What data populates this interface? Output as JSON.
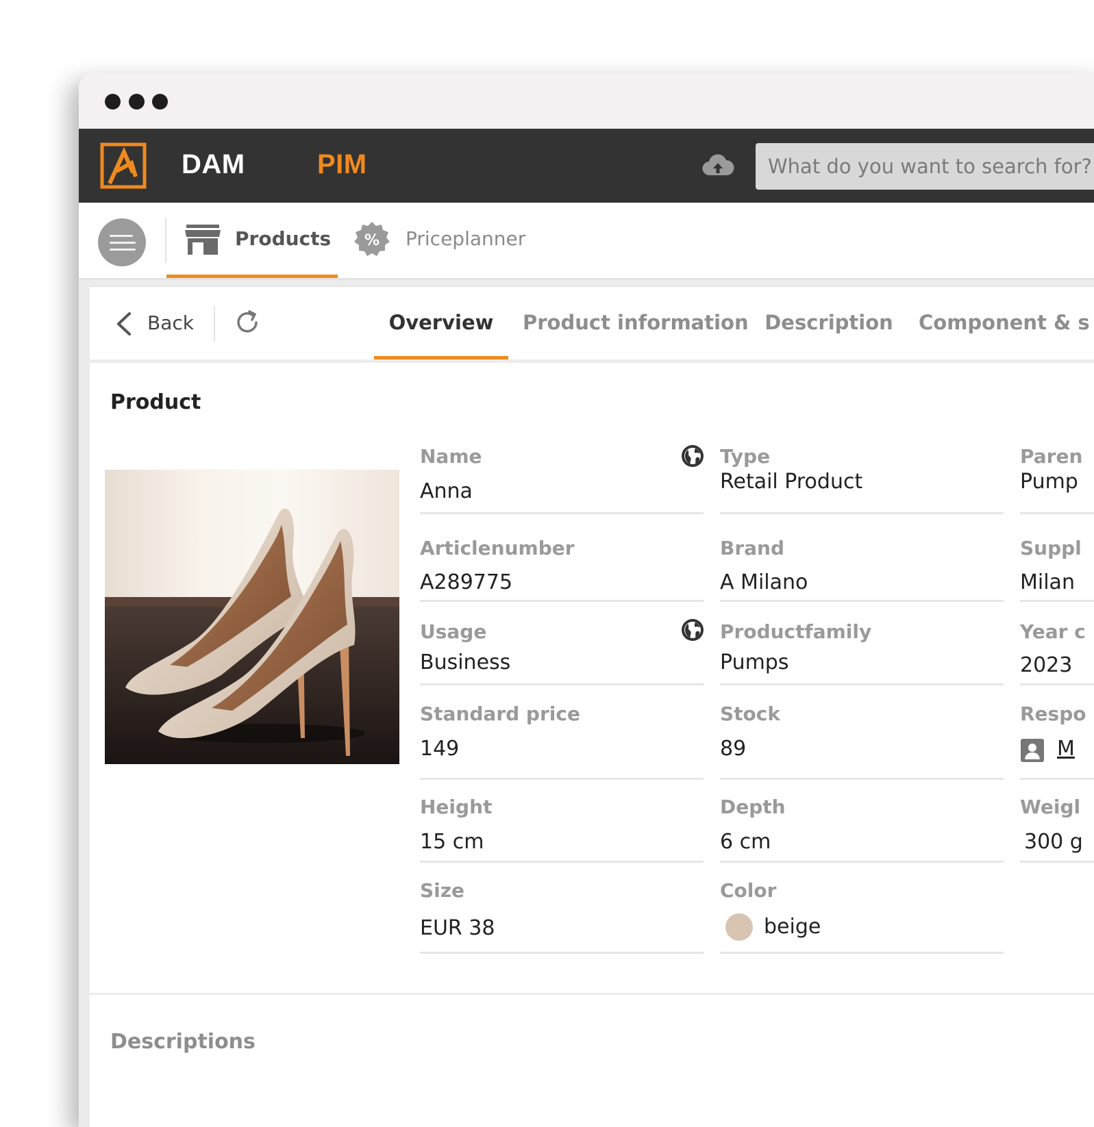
{
  "app": {
    "nav": {
      "dam": "DAM",
      "pim": "PIM"
    },
    "search": {
      "placeholder": "What do you want to search for?"
    },
    "modules": [
      {
        "label": "Products",
        "icon": "store-icon",
        "active": true
      },
      {
        "label": "Priceplanner",
        "icon": "percent-badge-icon",
        "active": false
      }
    ],
    "accent_color": "#f08a1e"
  },
  "toolbar": {
    "back_label": "Back",
    "tabs": [
      {
        "label": "Overview",
        "active": true
      },
      {
        "label": "Product information",
        "active": false
      },
      {
        "label": "Description",
        "active": false
      },
      {
        "label": "Component & s",
        "active": false
      }
    ]
  },
  "product": {
    "section_title": "Product",
    "fields": {
      "name": {
        "label": "Name",
        "value": "Anna"
      },
      "type": {
        "label": "Type",
        "value": "Retail Product"
      },
      "parent": {
        "label": "Paren",
        "value": "Pump"
      },
      "articlenumber": {
        "label": "Articlenumber",
        "value": "A289775"
      },
      "brand": {
        "label": "Brand",
        "value": "A Milano"
      },
      "supplier": {
        "label": "Suppl",
        "value": "Milan"
      },
      "usage": {
        "label": "Usage",
        "value": "Business"
      },
      "productfamily": {
        "label": "Productfamily",
        "value": "Pumps"
      },
      "year": {
        "label": "Year c",
        "value": "2023"
      },
      "standard_price": {
        "label": "Standard price",
        "value": "149"
      },
      "stock": {
        "label": "Stock",
        "value": "89"
      },
      "responsible": {
        "label": "Respo",
        "value": "M"
      },
      "height": {
        "label": "Height",
        "value": "15 cm"
      },
      "depth": {
        "label": "Depth",
        "value": "6 cm"
      },
      "weight": {
        "label": "Weigl",
        "value": "300 g"
      },
      "size": {
        "label": "Size",
        "value": "EUR 38"
      },
      "color": {
        "label": "Color",
        "value": "beige",
        "swatch": "#d8c4b2"
      }
    }
  },
  "descriptions": {
    "section_title": "Descriptions"
  }
}
